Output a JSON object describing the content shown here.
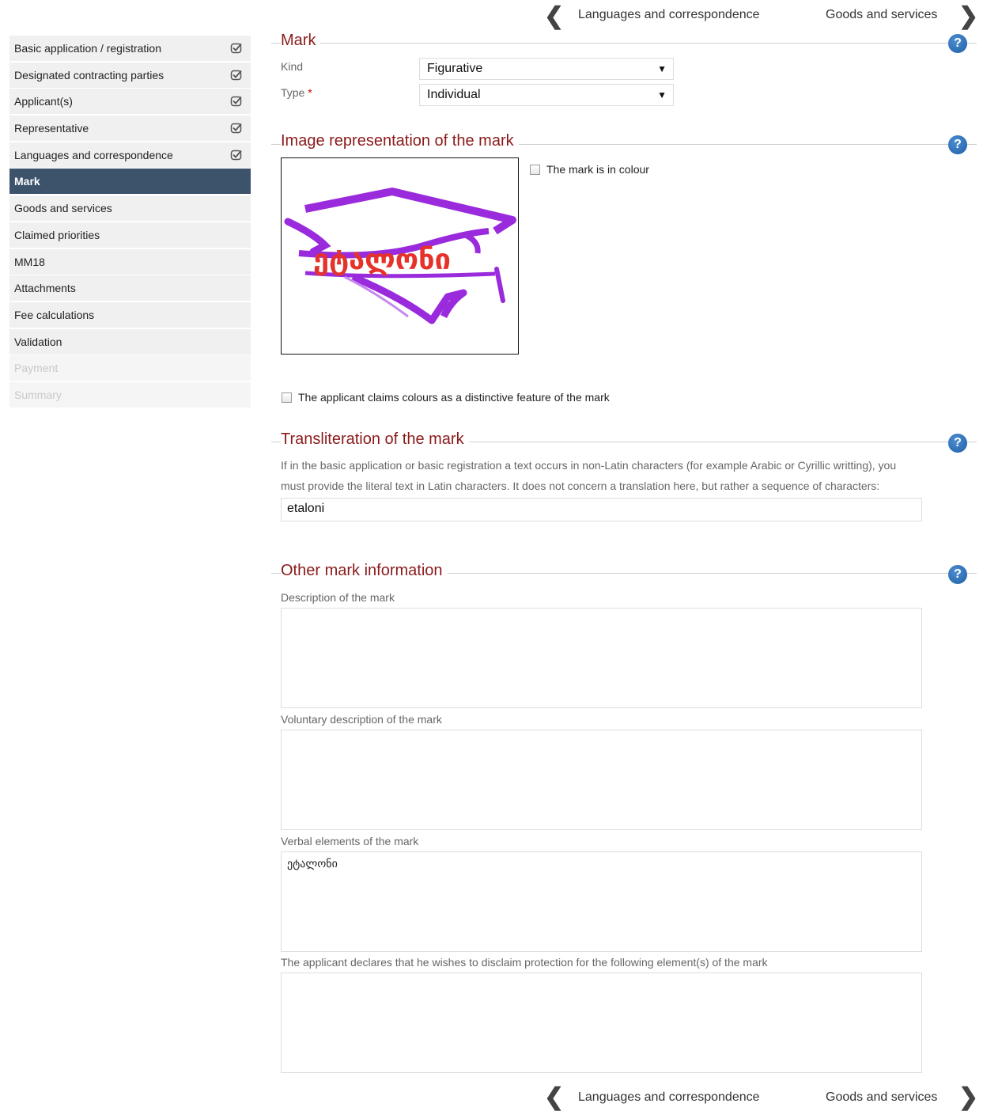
{
  "nav": {
    "prev_label": "Languages and correspondence",
    "next_label": "Goods and services"
  },
  "sidebar": {
    "items": [
      {
        "label": "Basic application / registration",
        "checked": true
      },
      {
        "label": "Designated contracting parties",
        "checked": true
      },
      {
        "label": "Applicant(s)",
        "checked": true
      },
      {
        "label": "Representative",
        "checked": true
      },
      {
        "label": "Languages and correspondence",
        "checked": true
      },
      {
        "label": "Mark",
        "active": true
      },
      {
        "label": "Goods and services"
      },
      {
        "label": "Claimed priorities"
      },
      {
        "label": "MM18"
      },
      {
        "label": "Attachments"
      },
      {
        "label": "Fee calculations"
      },
      {
        "label": "Validation"
      },
      {
        "label": "Payment",
        "disabled": true
      },
      {
        "label": "Summary",
        "disabled": true
      }
    ]
  },
  "mark_section": {
    "title": "Mark",
    "kind_label": "Kind",
    "kind_value": "Figurative",
    "type_label": "Type",
    "type_required": "*",
    "type_value": "Individual"
  },
  "image_section": {
    "title": "Image representation of the mark",
    "colour_checkbox_label": "The mark is in colour",
    "logo_text": "ეტალონი",
    "colours_claim_label": "The applicant claims colours as a distinctive feature of the mark",
    "logo_colors": {
      "cap": "#9a2bdc",
      "text": "#e5322b"
    }
  },
  "transliteration_section": {
    "title": "Transliteration of the mark",
    "help_text_line1": "If in the basic application or basic registration a text occurs in non-Latin characters (for example Arabic or Cyrillic writting), you",
    "help_text_line2": "must provide the literal text in Latin characters. It does not concern a translation here, but rather a sequence of characters:",
    "value": "etaloni"
  },
  "other_section": {
    "title": "Other mark information",
    "description_label": "Description of the mark",
    "description_value": "",
    "voluntary_label": "Voluntary description of the mark",
    "voluntary_value": "",
    "verbal_label": "Verbal elements of the mark",
    "verbal_value": "ეტალონი",
    "disclaim_label": "The applicant declares that he wishes to disclaim protection for the following element(s) of the mark",
    "disclaim_value": ""
  },
  "help_glyph": "?",
  "chevron_left": "❮",
  "chevron_right": "❯",
  "dropdown_arrow": "▼"
}
